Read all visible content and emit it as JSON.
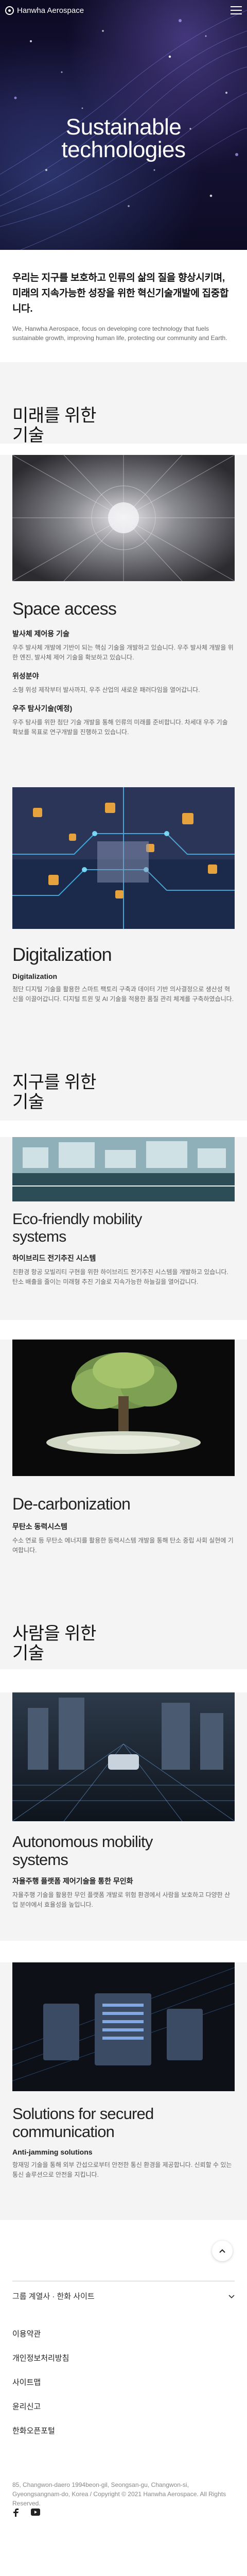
{
  "header": {
    "logo_text": "Hanwha Aerospace"
  },
  "hero": {
    "title_line1": "Sustainable",
    "title_line2": "technologies"
  },
  "intro": {
    "ko": "우리는 지구를 보호하고 인류의 삶의 질을 향상시키며, 미래의 지속가능한 성장을 위한 혁신기술개발에 집중합니다.",
    "en": "We, Hanwha Aerospace, focus on developing core technology that fuels sustainable growth, improving human life, protecting our community and Earth."
  },
  "sections": {
    "future": {
      "line1": "미래를 위한",
      "line2": "기술"
    },
    "earth": {
      "line1": "지구를 위한",
      "line2": "기술"
    },
    "people": {
      "line1": "사람을 위한",
      "line2": "기술"
    }
  },
  "cards": {
    "space": {
      "title": "Space access",
      "sub": "발사체 제어용 기술",
      "desc": "우주 발사체 개발에 기반이 되는 핵심 기술을 개발하고 있습니다. 우주 발사체 개발을 위한 엔진, 발사체 제어 기술을 확보하고 있습니다.",
      "item1_title": "위성분야",
      "item1_desc": "소형 위성 제작부터 발사까지, 우주 산업의 새로운 패러다임을 열어갑니다.",
      "item2_title": "우주 탐사기술(예정)",
      "item2_desc": "우주 탐사를 위한 첨단 기술 개발을 통해 인류의 미래를 준비합니다. 차세대 우주 기술 확보를 목표로 연구개발을 진행하고 있습니다."
    },
    "digital": {
      "title": "Digitalization",
      "sub": "Digitalization",
      "desc": "첨단 디지털 기술을 활용한 스마트 팩토리 구축과 데이터 기반 의사결정으로 생산성 혁신을 이끌어갑니다. 디지털 트윈 및 AI 기술을 적용한 품질 관리 체계를 구축하였습니다."
    },
    "eco": {
      "title_line1": "Eco-friendly mobility",
      "title_line2": "systems",
      "sub": "하이브리드 전기추진 시스템",
      "desc": "친환경 항공 모빌리티 구현을 위한 하이브리드 전기추진 시스템을 개발하고 있습니다. 탄소 배출을 줄이는 미래형 추진 기술로 지속가능한 하늘길을 열어갑니다."
    },
    "decarb": {
      "title": "De-carbonization",
      "sub": "무탄소 동력시스템",
      "desc": "수소 연료 등 무탄소 에너지를 활용한 동력시스템 개발을 통해 탄소 중립 사회 실현에 기여합니다."
    },
    "auto": {
      "title_line1": "Autonomous mobility",
      "title_line2": "systems",
      "sub": "자율주행 플랫폼 제어기술을 통한 무인화",
      "desc": "자율주행 기술을 활용한 무인 플랫폼 개발로 위험 환경에서 사람을 보호하고 다양한 산업 분야에서 효율성을 높입니다."
    },
    "comm": {
      "title_line1": "Solutions for secured",
      "title_line2": "communication",
      "sub": "Anti-jamming solutions",
      "desc": "항재밍 기술을 통해 외부 간섭으로부터 안전한 통신 환경을 제공합니다. 신뢰할 수 있는 통신 솔루션으로 안전을 지킵니다."
    }
  },
  "footer": {
    "family_label": "그룹 계열사 · 한화 사이트",
    "links": [
      "이용약관",
      "개인정보처리방침",
      "사이트맵",
      "윤리신고",
      "한화오픈포털"
    ],
    "copyright": "85, Changwon-daero 1994beon-gil, Seongsan-gu, Changwon-si, Gyeongsangnam-do, Korea / Copyright © 2021 Hanwha Aerospace. All Rights Reserved."
  }
}
